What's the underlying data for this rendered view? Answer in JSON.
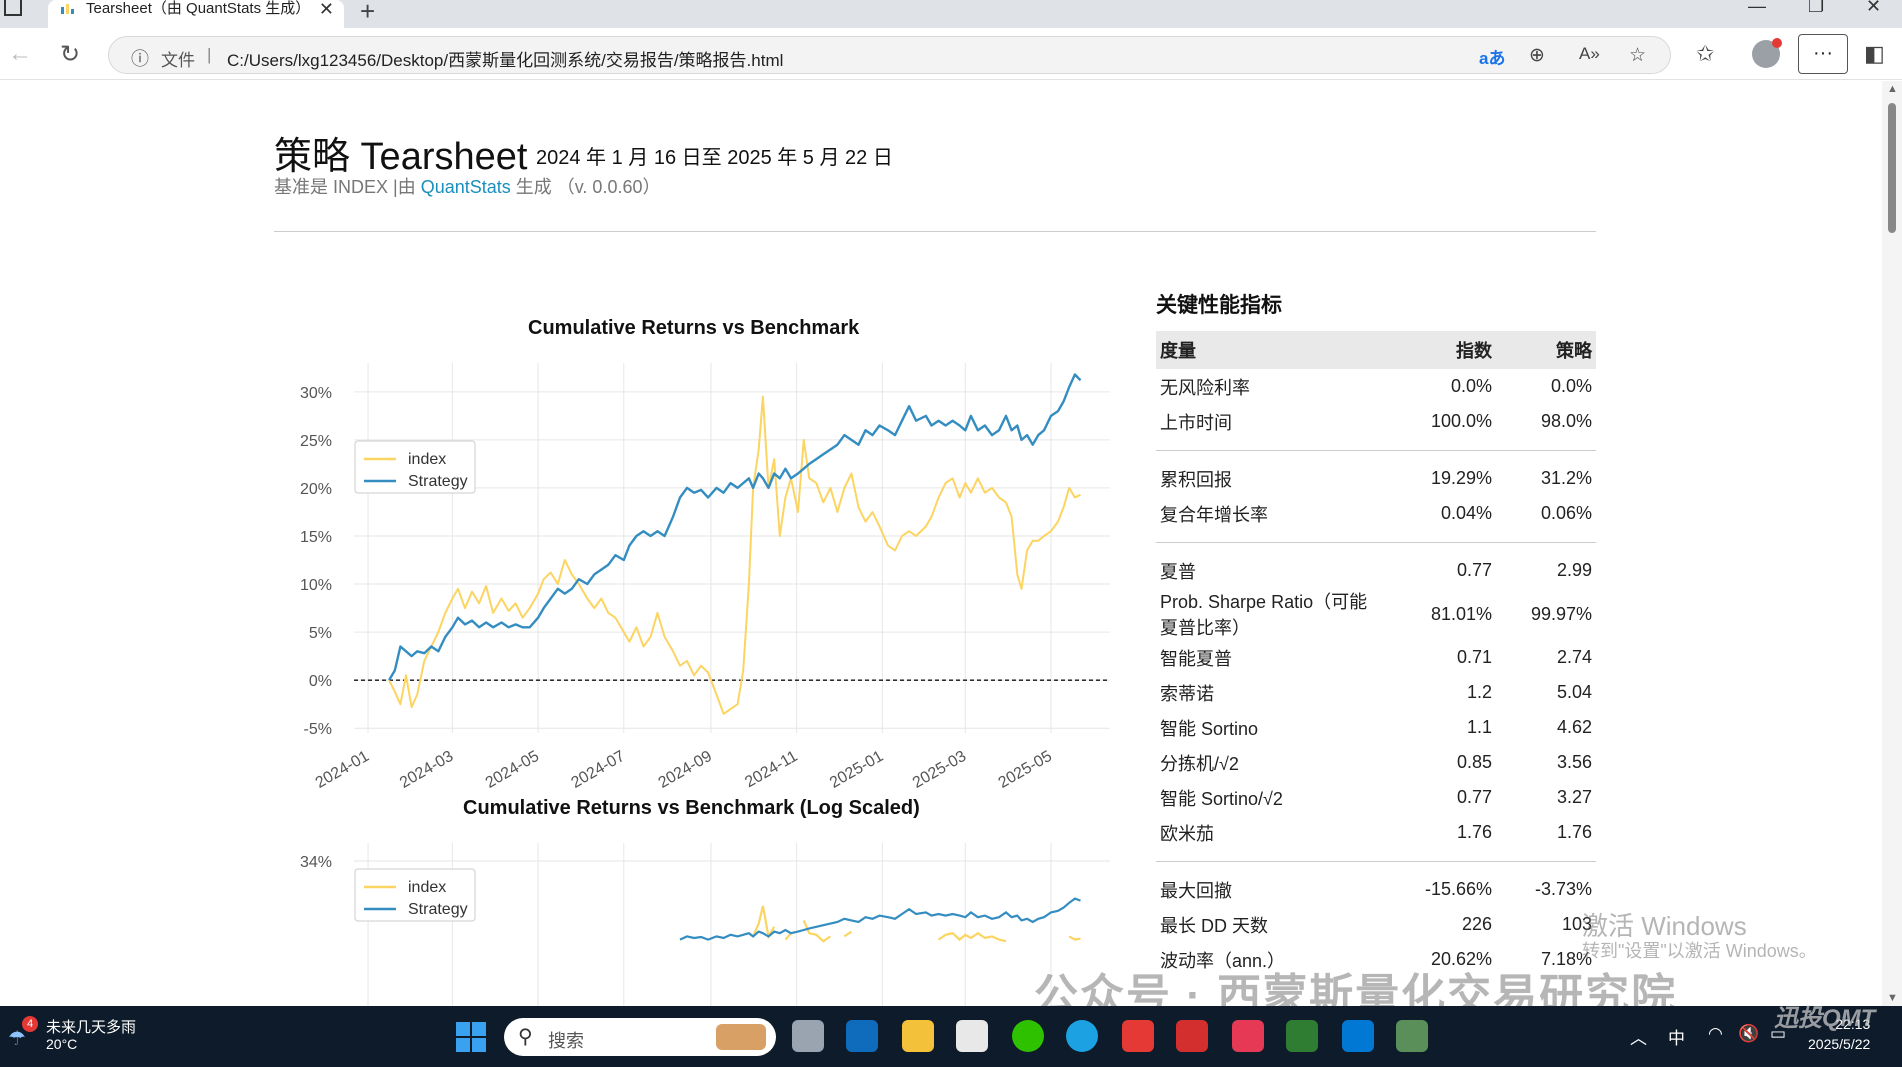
{
  "browser": {
    "tab_title": "Tearsheet（由 QuantStats 生成）",
    "url_protocol": "文件",
    "url": "C:/Users/lxg123456/Desktop/西蒙斯量化回测系统/交易报告/策略报告.html"
  },
  "report": {
    "title": "策略 Tearsheet",
    "date_range": "2024 年 1 月 16 日至 2025 年 5 月 22 日",
    "subtitle_prefix": "基准是 INDEX |由 ",
    "subtitle_link": "QuantStats",
    "subtitle_suffix": " 生成 （v. 0.0.60）"
  },
  "chart_data": [
    {
      "type": "line",
      "title": "Cumulative Returns vs Benchmark",
      "y_ticks": [
        "-5%",
        "0%",
        "5%",
        "10%",
        "15%",
        "20%",
        "25%",
        "30%"
      ],
      "y_tick_values": [
        -5,
        0,
        5,
        10,
        15,
        20,
        25,
        30
      ],
      "x_ticks": [
        "2024-01",
        "2024-03",
        "2024-05",
        "2024-07",
        "2024-09",
        "2024-11",
        "2025-01",
        "2025-03",
        "2025-05"
      ],
      "x_tick_values": [
        "2024-01-01",
        "2024-03-01",
        "2024-05-01",
        "2024-07-01",
        "2024-09-01",
        "2024-11-01",
        "2025-01-01",
        "2025-03-01",
        "2025-05-01"
      ],
      "ylim": [
        -5.5,
        33
      ],
      "xlim": [
        "2023-12-22",
        "2025-06-12"
      ],
      "grid": true,
      "legend": "top-left",
      "series": [
        {
          "name": "index",
          "color": "#fcd462",
          "points": [
            [
              "2024-01-16",
              0
            ],
            [
              "2024-01-20",
              -1.2
            ],
            [
              "2024-01-24",
              -2.5
            ],
            [
              "2024-01-28",
              0.5
            ],
            [
              "2024-02-01",
              -2.8
            ],
            [
              "2024-02-05",
              -1.5
            ],
            [
              "2024-02-10",
              2.0
            ],
            [
              "2024-02-15",
              3.5
            ],
            [
              "2024-02-20",
              5.0
            ],
            [
              "2024-02-25",
              7.0
            ],
            [
              "2024-03-01",
              8.5
            ],
            [
              "2024-03-05",
              9.5
            ],
            [
              "2024-03-10",
              7.5
            ],
            [
              "2024-03-15",
              9.2
            ],
            [
              "2024-03-20",
              8.0
            ],
            [
              "2024-03-25",
              9.8
            ],
            [
              "2024-03-30",
              7.0
            ],
            [
              "2024-04-05",
              8.5
            ],
            [
              "2024-04-10",
              7.2
            ],
            [
              "2024-04-15",
              8.0
            ],
            [
              "2024-04-20",
              6.5
            ],
            [
              "2024-04-25",
              7.5
            ],
            [
              "2024-05-01",
              9.0
            ],
            [
              "2024-05-05",
              10.5
            ],
            [
              "2024-05-10",
              11.2
            ],
            [
              "2024-05-15",
              10.0
            ],
            [
              "2024-05-20",
              12.5
            ],
            [
              "2024-05-25",
              11.0
            ],
            [
              "2024-05-30",
              10.0
            ],
            [
              "2024-06-05",
              8.5
            ],
            [
              "2024-06-10",
              7.5
            ],
            [
              "2024-06-15",
              8.5
            ],
            [
              "2024-06-20",
              7.0
            ],
            [
              "2024-06-25",
              6.5
            ],
            [
              "2024-07-01",
              5.0
            ],
            [
              "2024-07-05",
              4.0
            ],
            [
              "2024-07-10",
              5.5
            ],
            [
              "2024-07-15",
              3.5
            ],
            [
              "2024-07-20",
              4.5
            ],
            [
              "2024-07-25",
              7.0
            ],
            [
              "2024-07-30",
              4.5
            ],
            [
              "2024-08-05",
              3.0
            ],
            [
              "2024-08-10",
              1.5
            ],
            [
              "2024-08-15",
              2.0
            ],
            [
              "2024-08-20",
              0.5
            ],
            [
              "2024-08-25",
              1.5
            ],
            [
              "2024-08-30",
              0.8
            ],
            [
              "2024-09-05",
              -1.5
            ],
            [
              "2024-09-10",
              -3.5
            ],
            [
              "2024-09-15",
              -3.0
            ],
            [
              "2024-09-20",
              -2.5
            ],
            [
              "2024-09-24",
              1.0
            ],
            [
              "2024-09-28",
              10.0
            ],
            [
              "2024-10-01",
              20.0
            ],
            [
              "2024-10-05",
              24.0
            ],
            [
              "2024-10-08",
              29.5
            ],
            [
              "2024-10-12",
              20.0
            ],
            [
              "2024-10-16",
              23.0
            ],
            [
              "2024-10-20",
              15.0
            ],
            [
              "2024-10-24",
              19.0
            ],
            [
              "2024-10-28",
              21.0
            ],
            [
              "2024-11-02",
              17.5
            ],
            [
              "2024-11-06",
              25.0
            ],
            [
              "2024-11-10",
              21.0
            ],
            [
              "2024-11-15",
              20.5
            ],
            [
              "2024-11-20",
              18.5
            ],
            [
              "2024-11-25",
              20.0
            ],
            [
              "2024-11-30",
              17.5
            ],
            [
              "2024-12-05",
              20.0
            ],
            [
              "2024-12-10",
              21.5
            ],
            [
              "2024-12-15",
              18.0
            ],
            [
              "2024-12-20",
              16.5
            ],
            [
              "2024-12-25",
              17.5
            ],
            [
              "2024-12-30",
              16.0
            ],
            [
              "2025-01-05",
              14.0
            ],
            [
              "2025-01-10",
              13.5
            ],
            [
              "2025-01-15",
              15.0
            ],
            [
              "2025-01-20",
              15.5
            ],
            [
              "2025-01-25",
              15.0
            ],
            [
              "2025-02-01",
              16.0
            ],
            [
              "2025-02-05",
              17.0
            ],
            [
              "2025-02-10",
              19.0
            ],
            [
              "2025-02-15",
              20.5
            ],
            [
              "2025-02-20",
              21.0
            ],
            [
              "2025-02-25",
              19.0
            ],
            [
              "2025-03-01",
              20.5
            ],
            [
              "2025-03-05",
              19.5
            ],
            [
              "2025-03-10",
              21.0
            ],
            [
              "2025-03-15",
              19.5
            ],
            [
              "2025-03-20",
              20.0
            ],
            [
              "2025-03-25",
              19.0
            ],
            [
              "2025-03-30",
              18.5
            ],
            [
              "2025-04-03",
              17.0
            ],
            [
              "2025-04-07",
              11.0
            ],
            [
              "2025-04-10",
              9.5
            ],
            [
              "2025-04-14",
              13.5
            ],
            [
              "2025-04-18",
              14.5
            ],
            [
              "2025-04-22",
              14.5
            ],
            [
              "2025-04-26",
              15.0
            ],
            [
              "2025-05-01",
              15.5
            ],
            [
              "2025-05-06",
              16.5
            ],
            [
              "2025-05-10",
              18.0
            ],
            [
              "2025-05-14",
              20.0
            ],
            [
              "2025-05-18",
              19.0
            ],
            [
              "2025-05-22",
              19.3
            ]
          ]
        },
        {
          "name": "Strategy",
          "color": "#348dc1",
          "points": [
            [
              "2024-01-16",
              0
            ],
            [
              "2024-01-20",
              1.0
            ],
            [
              "2024-01-24",
              3.5
            ],
            [
              "2024-01-28",
              3.0
            ],
            [
              "2024-02-01",
              2.5
            ],
            [
              "2024-02-05",
              3.0
            ],
            [
              "2024-02-10",
              2.8
            ],
            [
              "2024-02-15",
              3.5
            ],
            [
              "2024-02-20",
              3.0
            ],
            [
              "2024-02-25",
              4.5
            ],
            [
              "2024-03-01",
              5.5
            ],
            [
              "2024-03-05",
              6.5
            ],
            [
              "2024-03-10",
              5.8
            ],
            [
              "2024-03-15",
              6.2
            ],
            [
              "2024-03-20",
              5.5
            ],
            [
              "2024-03-25",
              6.0
            ],
            [
              "2024-03-30",
              5.5
            ],
            [
              "2024-04-05",
              6.0
            ],
            [
              "2024-04-10",
              5.5
            ],
            [
              "2024-04-15",
              5.8
            ],
            [
              "2024-04-20",
              5.5
            ],
            [
              "2024-04-25",
              5.5
            ],
            [
              "2024-05-01",
              6.5
            ],
            [
              "2024-05-05",
              7.5
            ],
            [
              "2024-05-10",
              8.5
            ],
            [
              "2024-05-15",
              9.5
            ],
            [
              "2024-05-20",
              9.0
            ],
            [
              "2024-05-25",
              9.5
            ],
            [
              "2024-05-30",
              10.5
            ],
            [
              "2024-06-05",
              10.0
            ],
            [
              "2024-06-10",
              11.0
            ],
            [
              "2024-06-15",
              11.5
            ],
            [
              "2024-06-20",
              12.0
            ],
            [
              "2024-06-25",
              13.0
            ],
            [
              "2024-07-01",
              12.5
            ],
            [
              "2024-07-05",
              14.0
            ],
            [
              "2024-07-10",
              15.0
            ],
            [
              "2024-07-15",
              15.5
            ],
            [
              "2024-07-20",
              15.0
            ],
            [
              "2024-07-25",
              15.5
            ],
            [
              "2024-07-30",
              15.0
            ],
            [
              "2024-08-05",
              17.0
            ],
            [
              "2024-08-10",
              19.0
            ],
            [
              "2024-08-15",
              20.0
            ],
            [
              "2024-08-20",
              19.5
            ],
            [
              "2024-08-25",
              19.8
            ],
            [
              "2024-08-30",
              19.0
            ],
            [
              "2024-09-05",
              20.0
            ],
            [
              "2024-09-10",
              19.5
            ],
            [
              "2024-09-15",
              20.5
            ],
            [
              "2024-09-20",
              20.0
            ],
            [
              "2024-09-24",
              20.5
            ],
            [
              "2024-09-28",
              21.0
            ],
            [
              "2024-10-01",
              20.0
            ],
            [
              "2024-10-05",
              21.5
            ],
            [
              "2024-10-08",
              21.0
            ],
            [
              "2024-10-12",
              20.0
            ],
            [
              "2024-10-16",
              21.5
            ],
            [
              "2024-10-20",
              21.0
            ],
            [
              "2024-10-24",
              22.0
            ],
            [
              "2024-10-28",
              21.0
            ],
            [
              "2024-11-02",
              21.5
            ],
            [
              "2024-11-06",
              22.0
            ],
            [
              "2024-11-10",
              22.5
            ],
            [
              "2024-11-15",
              23.0
            ],
            [
              "2024-11-20",
              23.5
            ],
            [
              "2024-11-25",
              24.0
            ],
            [
              "2024-11-30",
              24.5
            ],
            [
              "2024-12-05",
              25.5
            ],
            [
              "2024-12-10",
              25.0
            ],
            [
              "2024-12-15",
              24.5
            ],
            [
              "2024-12-20",
              26.0
            ],
            [
              "2024-12-25",
              25.5
            ],
            [
              "2024-12-30",
              26.5
            ],
            [
              "2025-01-05",
              26.0
            ],
            [
              "2025-01-10",
              25.5
            ],
            [
              "2025-01-15",
              27.0
            ],
            [
              "2025-01-20",
              28.5
            ],
            [
              "2025-01-25",
              27.0
            ],
            [
              "2025-02-01",
              27.5
            ],
            [
              "2025-02-05",
              26.5
            ],
            [
              "2025-02-10",
              27.0
            ],
            [
              "2025-02-15",
              26.5
            ],
            [
              "2025-02-20",
              27.0
            ],
            [
              "2025-02-25",
              26.5
            ],
            [
              "2025-03-01",
              26.0
            ],
            [
              "2025-03-05",
              27.5
            ],
            [
              "2025-03-10",
              26.0
            ],
            [
              "2025-03-15",
              26.5
            ],
            [
              "2025-03-20",
              25.5
            ],
            [
              "2025-03-25",
              26.0
            ],
            [
              "2025-03-30",
              27.5
            ],
            [
              "2025-04-03",
              26.0
            ],
            [
              "2025-04-07",
              26.5
            ],
            [
              "2025-04-10",
              25.0
            ],
            [
              "2025-04-14",
              25.5
            ],
            [
              "2025-04-18",
              24.5
            ],
            [
              "2025-04-22",
              25.5
            ],
            [
              "2025-04-26",
              26.0
            ],
            [
              "2025-05-01",
              27.5
            ],
            [
              "2025-05-06",
              28.0
            ],
            [
              "2025-05-10",
              29.0
            ],
            [
              "2025-05-14",
              30.5
            ],
            [
              "2025-05-18",
              31.8
            ],
            [
              "2025-05-22",
              31.2
            ]
          ]
        }
      ]
    },
    {
      "type": "line",
      "title": "Cumulative Returns vs Benchmark (Log Scaled)",
      "y_ticks": [
        "34%"
      ],
      "y_tick_values": [
        34
      ],
      "log_scale": true,
      "grid": true,
      "legend": "top-left",
      "series": [
        {
          "name": "index",
          "color": "#fcd462"
        },
        {
          "name": "Strategy",
          "color": "#348dc1"
        }
      ]
    }
  ],
  "metrics": {
    "title": "关键性能指标",
    "headers": [
      "度量",
      "指数",
      "策略"
    ],
    "groups": [
      [
        [
          "无风险利率",
          "0.0%",
          "0.0%"
        ],
        [
          "上市时间",
          "100.0%",
          "98.0%"
        ]
      ],
      [
        [
          "累积回报",
          "19.29%",
          "31.2%"
        ],
        [
          "复合年增长率",
          "0.04%",
          "0.06%"
        ]
      ],
      [
        [
          "夏普",
          "0.77",
          "2.99"
        ],
        [
          "Prob. Sharpe Ratio（可能夏普比率）",
          "81.01%",
          "99.97%"
        ],
        [
          "智能夏普",
          "0.71",
          "2.74"
        ],
        [
          "索蒂诺",
          "1.2",
          "5.04"
        ],
        [
          "智能 Sortino",
          "1.1",
          "4.62"
        ],
        [
          "分拣机/√2",
          "0.85",
          "3.56"
        ],
        [
          "智能 Sortino/√2",
          "0.77",
          "3.27"
        ],
        [
          "欧米茄",
          "1.76",
          "1.76"
        ]
      ],
      [
        [
          "最大回撤",
          "-15.66%",
          "-3.73%"
        ],
        [
          "最长 DD 天数",
          "226",
          "103"
        ],
        [
          "波动率（ann.）",
          "20.62%",
          "7.18%"
        ]
      ]
    ]
  },
  "overlay": {
    "activate_title": "激活 Windows",
    "activate_hint": "转到\"设置\"以激活 Windows。",
    "wechat_watermark": "公众号 · 西蒙斯量化交易研究院",
    "corner_logo": "迅投QMT"
  },
  "taskbar": {
    "weather_badge": "4",
    "weather_text": "未来几天多雨",
    "temperature": "20°C",
    "search_label": "搜索",
    "ime": "中",
    "time": "22:13",
    "date": "2025/5/22"
  },
  "colors": {
    "accent": "#1a8fbf",
    "index_line": "#fcd462",
    "strategy_line": "#348dc1"
  }
}
